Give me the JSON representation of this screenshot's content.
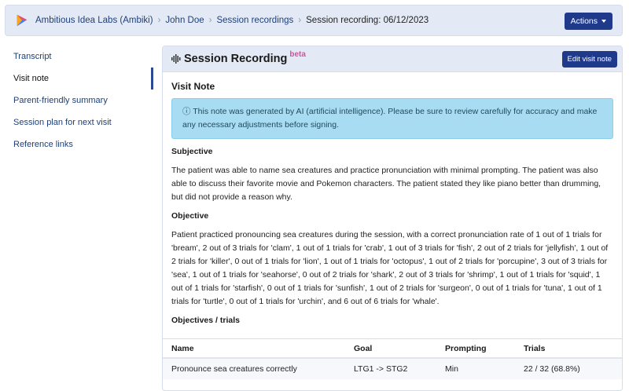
{
  "breadcrumbs": {
    "org": "Ambitious Idea Labs (Ambiki)",
    "patient": "John Doe",
    "section": "Session recordings",
    "current": "Session recording: 06/12/2023"
  },
  "header": {
    "actions_label": "Actions"
  },
  "sidebar": {
    "items": [
      {
        "label": "Transcript"
      },
      {
        "label": "Visit note"
      },
      {
        "label": "Parent-friendly summary"
      },
      {
        "label": "Session plan for next visit"
      },
      {
        "label": "Reference links"
      }
    ],
    "active": "Visit note"
  },
  "panel": {
    "title": "Session Recording",
    "badge": "beta",
    "edit_label": "Edit visit note"
  },
  "note": {
    "title": "Visit Note",
    "alert": "ⓘ This note was generated by AI (artificial intelligence). Please be sure to review carefully for accuracy and make any necessary adjustments before signing.",
    "subjective_heading": "Subjective",
    "subjective_text": "The patient was able to name sea creatures and practice pronunciation with minimal prompting. The patient was also able to discuss their favorite movie and Pokemon characters. The patient stated they like piano better than drumming, but did not provide a reason why.",
    "objective_heading": "Objective",
    "objective_text": "Patient practiced pronouncing sea creatures during the session, with a correct pronunciation rate of 1 out of 1 trials for 'bream', 2 out of 3 trials for 'clam', 1 out of 1 trials for 'crab', 1 out of 3 trials for 'fish', 2 out of 2 trials for 'jellyfish', 1 out of 2 trials for 'killer', 0 out of 1 trials for 'lion', 1 out of 1 trials for 'octopus', 1 out of 2 trials for 'porcupine', 3 out of 3 trials for 'sea', 1 out of 1 trials for 'seahorse', 0 out of 2 trials for 'shark', 2 out of 3 trials for 'shrimp', 1 out of 1 trials for 'squid', 1 out of 1 trials for 'starfish', 0 out of 1 trials for 'sunfish', 1 out of 2 trials for 'surgeon', 0 out of 1 trials for 'tuna', 1 out of 1 trials for 'turtle', 0 out of 1 trials for 'urchin', and 6 out of 6 trials for 'whale'.",
    "trials_heading": "Objectives / trials"
  },
  "table": {
    "headers": {
      "name": "Name",
      "goal": "Goal",
      "prompting": "Prompting",
      "trials": "Trials"
    },
    "rows": [
      {
        "name": "Pronounce sea creatures correctly",
        "goal": "LTG1 -> STG2",
        "prompting": "Min",
        "trials": "22 / 32 (68.8%)"
      }
    ]
  },
  "colors": {
    "accent": "#1f3a8a",
    "header_bg": "#e4eaf5",
    "alert_bg": "#a8dcf2",
    "beta": "#e04aa0"
  }
}
